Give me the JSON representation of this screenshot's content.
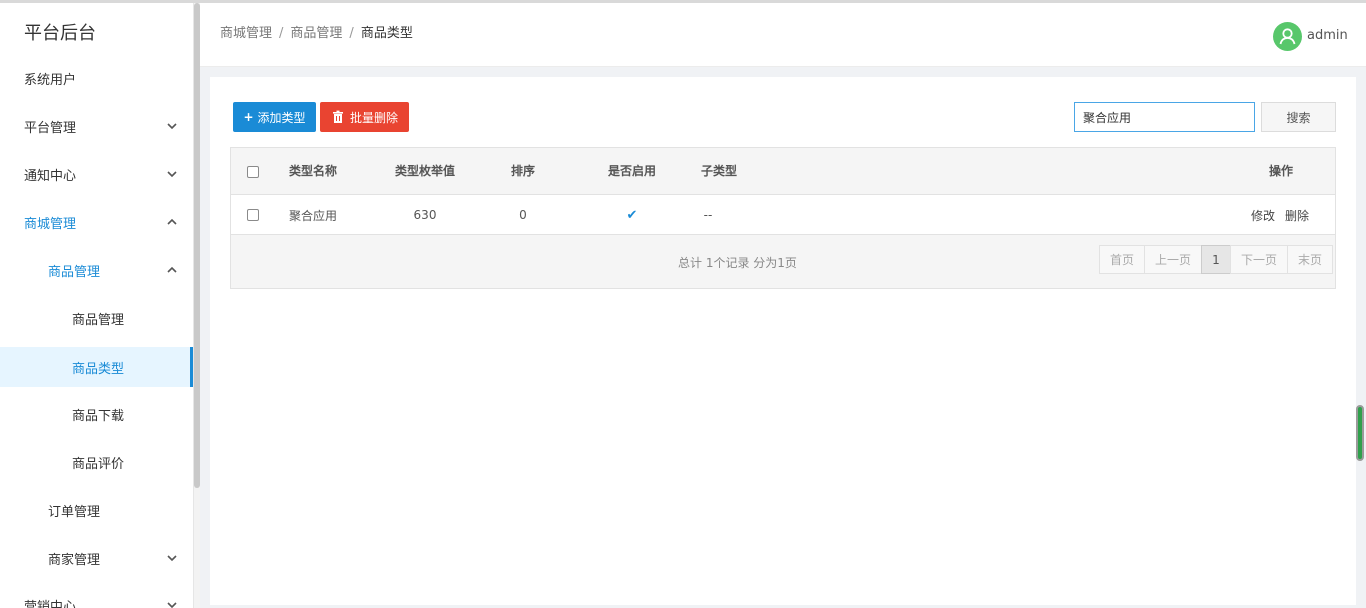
{
  "sidebar": {
    "title": "平台后台",
    "items": [
      {
        "label": "系统用户"
      },
      {
        "label": "平台管理"
      },
      {
        "label": "通知中心"
      },
      {
        "label": "商城管理"
      },
      {
        "label": "商品管理"
      },
      {
        "label": "商品管理"
      },
      {
        "label": "商品类型"
      },
      {
        "label": "商品下载"
      },
      {
        "label": "商品评价"
      },
      {
        "label": "订单管理"
      },
      {
        "label": "商家管理"
      },
      {
        "label": "营销中心"
      }
    ]
  },
  "header": {
    "breadcrumb": [
      "商城管理",
      "商品管理",
      "商品类型"
    ],
    "separator": "/",
    "username": "admin"
  },
  "toolbar": {
    "add_label": "添加类型",
    "batch_delete_label": "批量删除",
    "search_value": "聚合应用",
    "search_button": "搜索"
  },
  "table": {
    "headers": {
      "name": "类型名称",
      "enum_value": "类型枚举值",
      "sort": "排序",
      "enabled": "是否启用",
      "subtype": "子类型",
      "actions": "操作"
    },
    "rows": [
      {
        "name": "聚合应用",
        "enum_value": "630",
        "sort": "0",
        "enabled": "✔",
        "subtype": "--",
        "edit": "修改",
        "delete": "删除"
      }
    ],
    "summary": "总计 1个记录 分为1页"
  },
  "pagination": {
    "first": "首页",
    "prev": "上一页",
    "current": "1",
    "next": "下一页",
    "last": "末页"
  },
  "colors": {
    "primary": "#1a8bd6",
    "danger": "#e94431",
    "avatar": "#58c76b"
  }
}
